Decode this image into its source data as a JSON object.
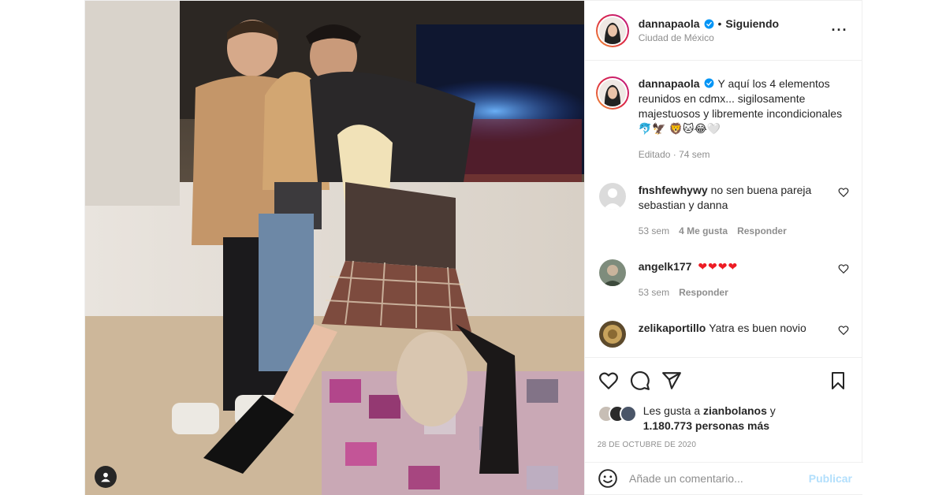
{
  "account": {
    "username": "dannapaola",
    "follow_status": "Siguiendo",
    "location": "Ciudad de México",
    "verified": true
  },
  "caption": {
    "text": "Y aquí los 4 elementos reunidos en cdmx... sigilosamente majestuosos y libremente incondicionales 🐬🦅 🦁🐱😂🤍",
    "edited": "Editado",
    "time": "74 sem"
  },
  "comments": [
    {
      "username": "fnshfewhywy",
      "text": "no sen buena pareja sebastian y danna",
      "time": "53 sem",
      "likes": "4 Me gusta",
      "reply": "Responder"
    },
    {
      "username": "angelk177",
      "text": "❤❤❤❤",
      "time": "53 sem",
      "reply": "Responder"
    },
    {
      "username": "zelikaportillo",
      "text": "Yatra es buen novio"
    }
  ],
  "likes": {
    "prefix": "Les gusta a",
    "first_user": "zianbolanos",
    "joiner": "y",
    "others": "1.180.773 personas más"
  },
  "date": "28 DE OCTUBRE DE 2020",
  "add_comment": {
    "placeholder": "Añade un comentario...",
    "publish": "Publicar"
  },
  "icons": [
    "heart-icon",
    "comment-icon",
    "share-icon",
    "bookmark-icon",
    "emoji-icon",
    "more-options-icon",
    "user-tag-icon",
    "verified-icon"
  ],
  "colors": {
    "accent": "#0095f6",
    "publish_disabled": "#b2dffc",
    "secondary_text": "#8e8e8e",
    "border": "#efefef",
    "heart_red": "#ed1c24"
  }
}
